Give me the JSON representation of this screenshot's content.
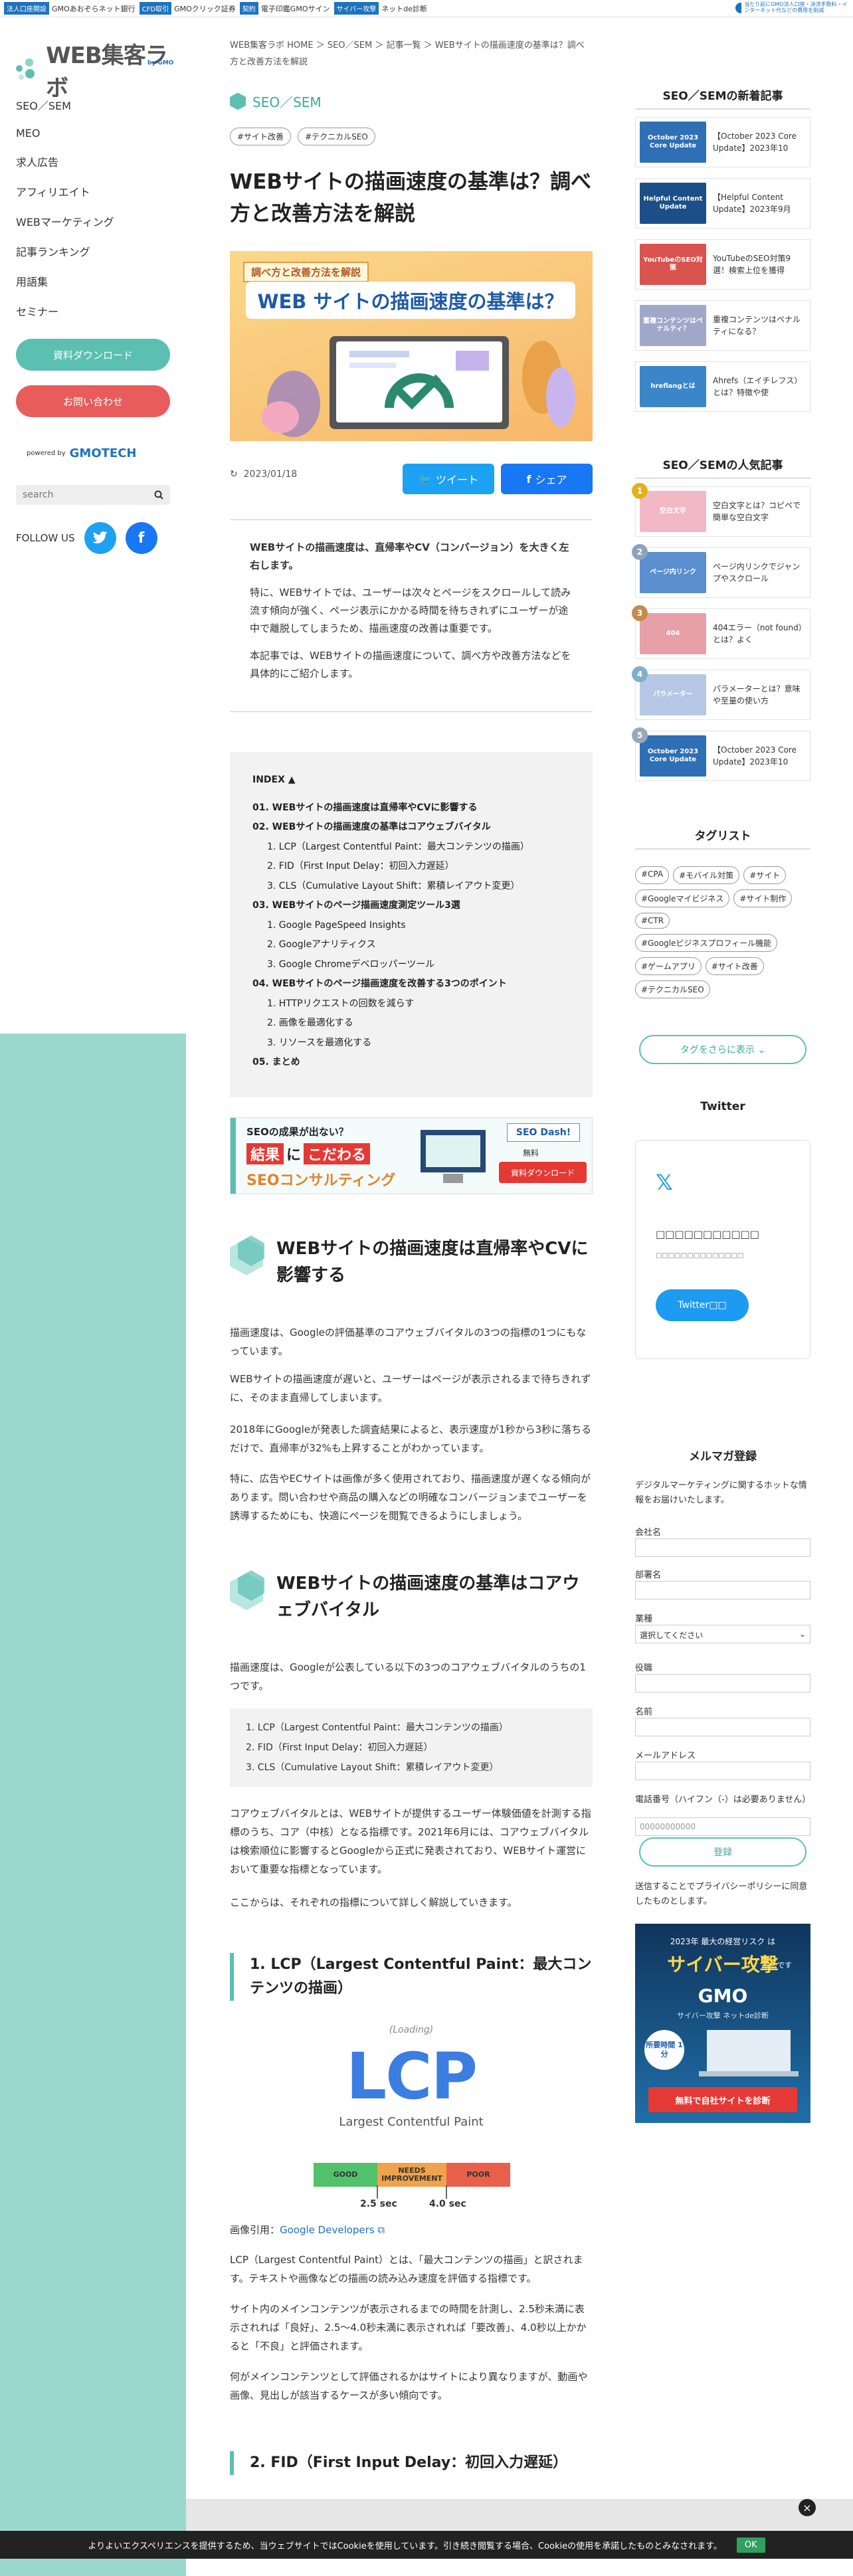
{
  "top_bar": {
    "items": [
      {
        "badge": "法人口座開設",
        "label": "GMOあおぞらネット銀行"
      },
      {
        "badge": "CFD取引",
        "label": "GMOクリック証券"
      },
      {
        "badge": "契約",
        "label": "電子印鑑GMOサイン"
      },
      {
        "badge": "サイバー攻撃",
        "label": "ネットde診断"
      }
    ],
    "right_text": "当たり前にGMO法人口座・決済手数料・インターネット代などの費用を削減"
  },
  "sidebar": {
    "logo_text": "WEB集客ラボ",
    "logo_sub": "by GMO",
    "nav": [
      "SEO／SEM",
      "MEO",
      "求人広告",
      "アフィリエイト",
      "WEBマーケティング",
      "記事ランキング",
      "用語集",
      "セミナー"
    ],
    "download_btn": "資料ダウンロード",
    "contact_btn": "お問い合わせ",
    "powered_by": "powered by",
    "powered_brand": "GMOTECH",
    "search_placeholder": "search",
    "follow_us": "FOLLOW US",
    "colors": {
      "teal": "#5bbfb2",
      "red": "#e85c5c",
      "twitter": "#1da1f2",
      "facebook": "#1877f2"
    }
  },
  "article": {
    "breadcrumb": "WEB集客ラボ HOME ＞ SEO／SEM ＞ 記事一覧 ＞ WEBサイトの描画速度の基準は？調べ方と改善方法を解説",
    "category": "SEO／SEM",
    "tags": [
      "#サイト改善",
      "#テクニカルSEO"
    ],
    "title": "WEBサイトの描画速度の基準は？調べ方と改善方法を解説",
    "hero_label": "調べ方と改善方法を解説",
    "hero_title": "WEB サイトの描画速度の基準は？",
    "date": "2023/01/18",
    "tweet_btn": "ツイート",
    "share_btn": "シェア",
    "intro": [
      "WEBサイトの描画速度は、直帰率やCV（コンバージョン）を大きく左右します。",
      "特に、WEBサイトでは、ユーザーは次々とページをスクロールして読み流す傾向が強く、ページ表示にかかる時間を待ちきれずにユーザーが途中で離脱してしまうため、描画速度の改善は重要です。",
      "本記事では、WEBサイトの描画速度について、調べ方や改善方法などを具体的にご紹介します。"
    ],
    "toc_title": "INDEX ▲",
    "toc": [
      {
        "level": 1,
        "text": "01. WEBサイトの描画速度は直帰率やCVに影響する"
      },
      {
        "level": 1,
        "text": "02. WEBサイトの描画速度の基準はコアウェブバイタル"
      },
      {
        "level": 2,
        "text": "1. LCP（Largest Contentful Paint：最大コンテンツの描画）"
      },
      {
        "level": 2,
        "text": "2. FID（First Input Delay：初回入力遅延）"
      },
      {
        "level": 2,
        "text": "3. CLS（Cumulative Layout Shift：累積レイアウト変更）"
      },
      {
        "level": 1,
        "text": "03. WEBサイトのページ描画速度測定ツール3選"
      },
      {
        "level": 2,
        "text": "1. Google PageSpeed Insights"
      },
      {
        "level": 2,
        "text": "2. Googleアナリティクス"
      },
      {
        "level": 2,
        "text": "3. Google Chromeデベロッパーツール"
      },
      {
        "level": 1,
        "text": "04. WEBサイトのページ描画速度を改善する3つのポイント"
      },
      {
        "level": 2,
        "text": "1. HTTPリクエストの回数を減らす"
      },
      {
        "level": 2,
        "text": "2. 画像を最適化する"
      },
      {
        "level": 2,
        "text": "3. リソースを最適化する"
      },
      {
        "level": 1,
        "text": "05. まとめ"
      }
    ],
    "banner": {
      "line1": "SEOの成果が出ない？",
      "line2a": "結果",
      "line2b": "に",
      "line2c": "こだわる",
      "line3": "SEOコンサルティング",
      "brand": "SEO Dash!",
      "free": "無料",
      "dl": "資料ダウンロード"
    },
    "h2_1": "WEBサイトの描画速度は直帰率やCVに影響する",
    "p1": "描画速度は、Googleの評価基準のコアウェブバイタルの3つの指標の1つにもなっています。",
    "p2": "WEBサイトの描画速度が遅いと、ユーザーはページが表示されるまで待ちきれずに、そのまま直帰してしまいます。",
    "p3": "2018年にGoogleが発表した調査結果によると、表示速度が1秒から3秒に落ちるだけで、直帰率が32%も上昇することがわかっています。",
    "p4": "特に、広告やECサイトは画像が多く使用されており、描画速度が遅くなる傾向があります。問い合わせや商品の購入などの明確なコンバージョンまでユーザーを誘導するためにも、快適にページを閲覧できるようにしましょう。",
    "h2_2": "WEBサイトの描画速度の基準はコアウェブバイタル",
    "p5": "描画速度は、Googleが公表している以下の3つのコアウェブバイタルのうちの1つです。",
    "list": [
      "1. LCP（Largest Contentful Paint：最大コンテンツの描画）",
      "2. FID（First Input Delay：初回入力遅延）",
      "3. CLS（Cumulative Layout Shift：累積レイアウト変更）"
    ],
    "p6": "コアウェブバイタルとは、WEBサイトが提供するユーザー体験価値を計測する指標のうち、コア（中核）となる指標です。2021年6月には、コアウェブバイタルは検索順位に影響するとGoogleから正式に発表されており、WEBサイト運営において重要な指標となっています。",
    "p7": "ここからは、それぞれの指標について詳しく解説していきます。",
    "h3_1": "1. LCP（Largest Contentful Paint：最大コンテンツの描画）",
    "lcp_loading": "(Loading)",
    "lcp_big": "LCP",
    "lcp_sub": "Largest Contentful Paint",
    "scale": [
      "GOOD",
      "NEEDS IMPROVEMENT",
      "POOR"
    ],
    "ticks": [
      "2.5 sec",
      "4.0 sec"
    ],
    "ref_prefix": "画像引用：",
    "ref_link": "Google Developers",
    "p8": "LCP（Largest Contentful Paint）とは、「最大コンテンツの描画」と訳されます。テキストや画像などの描画の読み込み速度を評価する指標です。",
    "p9": "サイト内のメインコンテンツが表示されるまでの時間を計測し、2.5秒未満に表示されれば「良好」、2.5〜4.0秒未満に表示されれば「要改善」、4.0秒以上かかると「不良」と評価されます。",
    "p10": "何がメインコンテンツとして評価されるかはサイトにより異なりますが、動画や画像、見出しが該当するケースが多い傾向です。",
    "h3_2": "2. FID（First Input Delay：初回入力遅延）"
  },
  "right": {
    "new_title": "SEO／SEMの新着記事",
    "new_articles": [
      {
        "thumb": "October 2023 Core Update",
        "title": "【October 2023 Core Update】2023年10",
        "color": "#2f6fb5"
      },
      {
        "thumb": "Helpful Content Update",
        "title": "【Helpful Content Update】2023年9月",
        "color": "#1c4f87"
      },
      {
        "thumb": "YouTubeのSEO対策",
        "title": "YouTubeのSEO対策9選！検索上位を獲得",
        "color": "#d9534f"
      },
      {
        "thumb": "重複コンテンツはペナルティ？",
        "title": "重複コンテンツはペナルティになる？",
        "color": "#9fa8c8"
      },
      {
        "thumb": "hreflangとは",
        "title": "Ahrefs（エイチレフス）とは？特徴や使",
        "color": "#3a86c8"
      }
    ],
    "popular_title": "SEO／SEMの人気記事",
    "popular_articles": [
      {
        "rank": "1",
        "thumb": "空白文字",
        "title": "空白文字とは？コピペで簡単な空白文字",
        "color": "#f2b8c6"
      },
      {
        "rank": "2",
        "thumb": "ページ内リンク",
        "title": "ページ内リンクでジャンプやスクロール",
        "color": "#5a8fd0"
      },
      {
        "rank": "3",
        "thumb": "404",
        "title": "404エラー（not found）とは？よく",
        "color": "#e7a0a8"
      },
      {
        "rank": "4",
        "thumb": "パラメーター",
        "title": "パラメーターとは？意味や至量の使い方",
        "color": "#b7c7e6"
      },
      {
        "rank": "5",
        "thumb": "October 2023 Core Update",
        "title": "【October 2023 Core Update】2023年10",
        "color": "#2f6fb5"
      }
    ],
    "tag_title": "タグリスト",
    "tags": [
      "#CPA",
      "#モバイル対策",
      "#サイト",
      "#Googleマイビジネス",
      "#サイト制作",
      "#CTR",
      "#Googleビジネスプロフィール機能",
      "#ゲームアプリ",
      "#サイト改善",
      "#テクニカルSEO"
    ],
    "more_tags": "タグをさらに表示 ⌄",
    "twitter_title": "Twitter",
    "twitter_blank1": "□□□□□□□□□□□",
    "twitter_blank2": "□□□□□□□□□□□□□□",
    "twitter_btn": "Twitter□□",
    "mail_title": "メルマガ登録",
    "mail_desc": "デジタルマーケティングに関するホットな情報をお届けいたします。",
    "fields": [
      "会社名",
      "部署名",
      "業種",
      "役職",
      "名前",
      "メールアドレス",
      "電話番号（ハイフン（-）は必要ありません）"
    ],
    "industry_placeholder": "選択してください",
    "phone_placeholder": "00000000000",
    "register_btn": "登録",
    "privacy": "送信することでプライバシーポリシーに同意したものとします。",
    "cyber": {
      "top": "2023年 最大の経営リスク は",
      "big": "サイバー攻撃",
      "suffix": "です",
      "brand": "GMO",
      "sub": "サイバー攻撃 ネットde診断",
      "time": "所要時間 1分",
      "cta": "無料で自社サイトを診断"
    }
  },
  "cookie": {
    "text": "よりよいエクスペリエンスを提供するため、当ウェブサイトではCookieを使用しています。引き続き閲覧する場合、Cookieの使用を承諾したものとみなされます。",
    "ok": "OK"
  }
}
